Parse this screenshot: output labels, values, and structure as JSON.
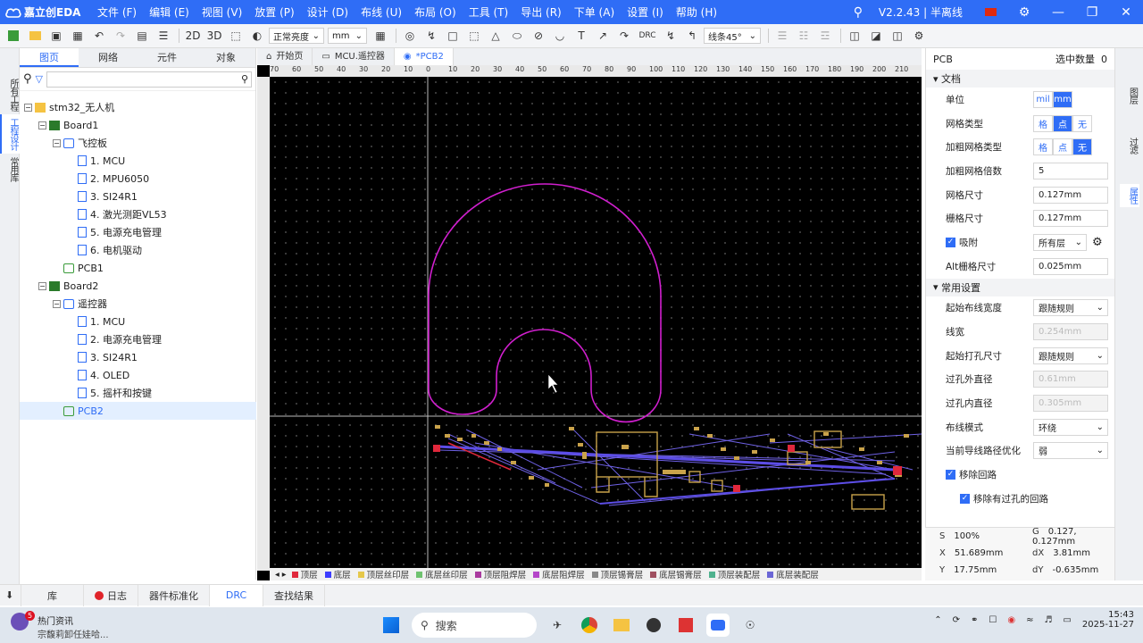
{
  "app": {
    "name": "嘉立创EDA",
    "version": "V2.2.43",
    "mode": "半离线"
  },
  "menu": [
    "文件 (F)",
    "编辑 (E)",
    "视图 (V)",
    "放置 (P)",
    "设计 (D)",
    "布线 (U)",
    "布局 (O)",
    "工具 (T)",
    "导出 (R)",
    "下单 (A)",
    "设置 (I)",
    "帮助 (H)"
  ],
  "toolbar": {
    "view2d": "2D",
    "view3d": "3D",
    "brightness": "正常亮度",
    "unit": "mm",
    "drc": "DRC",
    "route_angle": "线条45°"
  },
  "left_vtabs": [
    "所有工程",
    "工程设计",
    "常用库"
  ],
  "panel": {
    "tabs": [
      "图页",
      "网络",
      "元件",
      "对象"
    ],
    "active_tab": 0
  },
  "tree": [
    {
      "label": "stm32_无人机",
      "level": 0,
      "kind": "folder",
      "toggle": "−"
    },
    {
      "label": "Board1",
      "level": 1,
      "kind": "board",
      "toggle": "−"
    },
    {
      "label": "飞控板",
      "level": 2,
      "kind": "sch",
      "toggle": "−"
    },
    {
      "label": "1. MCU",
      "level": 3,
      "kind": "page"
    },
    {
      "label": "2. MPU6050",
      "level": 3,
      "kind": "page"
    },
    {
      "label": "3. SI24R1",
      "level": 3,
      "kind": "page"
    },
    {
      "label": "4. 激光测距VL53",
      "level": 3,
      "kind": "page"
    },
    {
      "label": "5. 电源充电管理",
      "level": 3,
      "kind": "page"
    },
    {
      "label": "6. 电机驱动",
      "level": 3,
      "kind": "page"
    },
    {
      "label": "PCB1",
      "level": 2,
      "kind": "pcb"
    },
    {
      "label": "Board2",
      "level": 1,
      "kind": "board",
      "toggle": "−"
    },
    {
      "label": "遥控器",
      "level": 2,
      "kind": "sch",
      "toggle": "−"
    },
    {
      "label": "1. MCU",
      "level": 3,
      "kind": "page"
    },
    {
      "label": "2. 电源充电管理",
      "level": 3,
      "kind": "page"
    },
    {
      "label": "3. SI24R1",
      "level": 3,
      "kind": "page"
    },
    {
      "label": "4. OLED",
      "level": 3,
      "kind": "page"
    },
    {
      "label": "5. 摇杆和按键",
      "level": 3,
      "kind": "page"
    },
    {
      "label": "PCB2",
      "level": 2,
      "kind": "pcb",
      "selected": true
    }
  ],
  "doc_tabs": [
    {
      "label": "开始页"
    },
    {
      "label": "MCU.遥控器"
    },
    {
      "label": "*PCB2",
      "active": true
    }
  ],
  "ruler_marks": [
    "70",
    "60",
    "50",
    "40",
    "30",
    "20",
    "10",
    "0",
    "10",
    "20",
    "30",
    "40",
    "50",
    "60",
    "70",
    "80",
    "90",
    "100",
    "110",
    "120",
    "130",
    "140",
    "150",
    "160",
    "170",
    "180",
    "190",
    "200",
    "210"
  ],
  "layers": [
    {
      "name": "顶层",
      "color": "#e0283c"
    },
    {
      "name": "底层",
      "color": "#3d3dff"
    },
    {
      "name": "顶层丝印层",
      "color": "#e6c84a"
    },
    {
      "name": "底层丝印层",
      "color": "#6fc26f"
    },
    {
      "name": "顶层阻焊层",
      "color": "#a93a9e"
    },
    {
      "name": "底层阻焊层",
      "color": "#b546c9"
    },
    {
      "name": "顶层锡膏层",
      "color": "#888888"
    },
    {
      "name": "底层锡膏层",
      "color": "#a05060"
    },
    {
      "name": "顶层装配层",
      "color": "#4fb28e"
    },
    {
      "name": "底层装配层",
      "color": "#6b66d6"
    }
  ],
  "props": {
    "header": "PCB",
    "selected_label": "选中数量",
    "selected_count": "0",
    "section_doc": "文档",
    "section_common": "常用设置",
    "unit": {
      "label": "单位",
      "options": [
        "mil",
        "mm"
      ],
      "active": 1
    },
    "grid_type": {
      "label": "网格类型",
      "options": [
        "格",
        "点",
        "无"
      ],
      "active": 1
    },
    "bold_grid_type": {
      "label": "加粗网格类型",
      "options": [
        "格",
        "点",
        "无"
      ],
      "active": 2
    },
    "bold_grid_mult": {
      "label": "加粗网格倍数",
      "value": "5"
    },
    "grid_size": {
      "label": "网格尺寸",
      "value": "0.127mm"
    },
    "fence_size": {
      "label": "栅格尺寸",
      "value": "0.127mm"
    },
    "snap": {
      "label": "吸附",
      "value": "所有层"
    },
    "alt_grid": {
      "label": "Alt栅格尺寸",
      "value": "0.025mm"
    },
    "route_width_start": {
      "label": "起始布线宽度",
      "value": "跟随规则"
    },
    "line_width": {
      "label": "线宽",
      "value": "0.254mm"
    },
    "via_start": {
      "label": "起始打孔尺寸",
      "value": "跟随规则"
    },
    "via_outer": {
      "label": "过孔外直径",
      "value": "0.61mm"
    },
    "via_inner": {
      "label": "过孔内直径",
      "value": "0.305mm"
    },
    "route_mode": {
      "label": "布线模式",
      "value": "环绕"
    },
    "path_opt": {
      "label": "当前导线路径优化",
      "value": "弱"
    },
    "remove_loop": {
      "label": "移除回路"
    },
    "remove_via_loop": {
      "label": "移除有过孔的回路"
    }
  },
  "status": {
    "scale_k": "S",
    "scale": "100%",
    "g_k": "G",
    "grid": "0.127, 0.127mm",
    "x_k": "X",
    "x": "51.689mm",
    "dx_k": "dX",
    "dx": "3.81mm",
    "y_k": "Y",
    "y": "17.75mm",
    "dy_k": "dY",
    "dy": "-0.635mm"
  },
  "right_vtabs": [
    "图层",
    "过滤",
    "属性"
  ],
  "bottom_tabs": [
    "库",
    "日志",
    "器件标准化",
    "DRC",
    "查找结果"
  ],
  "taskbar": {
    "news_badge": "5",
    "news_title": "热门资讯",
    "news_sub": "宗馥莉卸任娃哈...",
    "search": "搜索",
    "time": "15:43",
    "date": "2025-11-27"
  }
}
